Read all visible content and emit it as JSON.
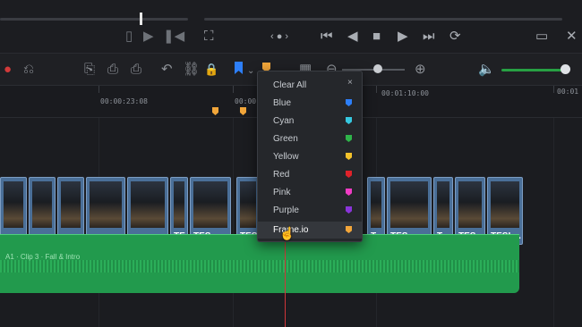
{
  "viewer": {
    "left_controls": [
      "▯",
      "▶",
      "❚◀",
      "❙◀"
    ],
    "right_controls": [
      "⏮",
      "◀",
      "■",
      "▶",
      "⏭",
      "⟳"
    ],
    "right_extra": [
      "▭",
      "✕"
    ],
    "crop_icon": "⛶",
    "dot_nav": "‹ ● ›"
  },
  "toolbar": {
    "icons": [
      "⎌",
      "⎘",
      "⎙",
      "↶",
      "⛓",
      "🔒",
      "▦",
      "⊖",
      "⊕",
      "🔈"
    ]
  },
  "timecodes": [
    "00:00:23:08",
    "00:00:46",
    "00:01:10:00",
    "00:01"
  ],
  "dropdown": {
    "close": "×",
    "items": [
      {
        "label": "Clear All",
        "color": ""
      },
      {
        "label": "Blue",
        "color": "#2d7ff9"
      },
      {
        "label": "Cyan",
        "color": "#36c8e0"
      },
      {
        "label": "Green",
        "color": "#2fb44a"
      },
      {
        "label": "Yellow",
        "color": "#f3c22b"
      },
      {
        "label": "Red",
        "color": "#e0222a"
      },
      {
        "label": "Pink",
        "color": "#f03cc4"
      },
      {
        "label": "Purple",
        "color": "#8a34d9"
      },
      {
        "label": "Frame.io",
        "color": "#f2a63a"
      }
    ]
  },
  "clips": [
    {
      "label": ""
    },
    {
      "label": ""
    },
    {
      "label": ""
    },
    {
      "label": ""
    },
    {
      "label": ""
    },
    {
      "label": "TE..."
    },
    {
      "label": "TES..."
    },
    {
      "label": "TES..."
    },
    {
      "label": "T..."
    },
    {
      "label": "TES..."
    },
    {
      "label": "T..."
    },
    {
      "label": "TES..."
    },
    {
      "label": "TESL..."
    }
  ],
  "audio": {
    "name": "A1 · Clip 3 · Fall & Intro"
  }
}
